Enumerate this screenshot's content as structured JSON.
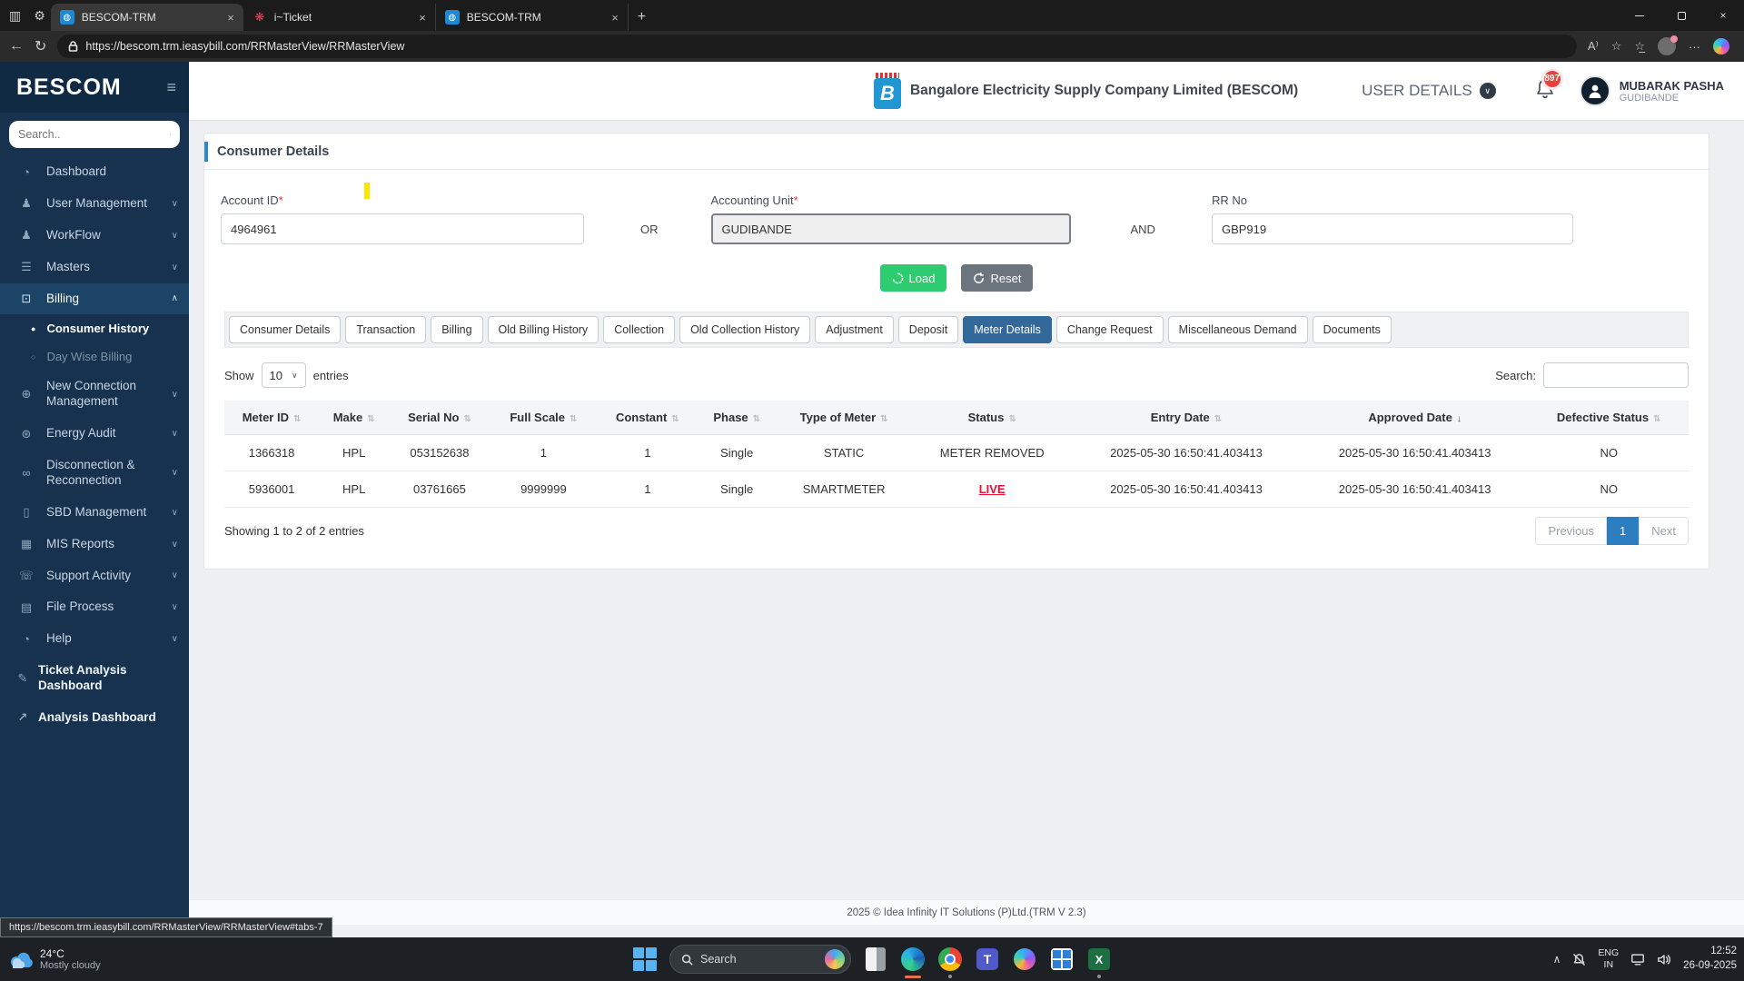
{
  "browser": {
    "tabs": [
      {
        "title": "BESCOM-TRM"
      },
      {
        "title": "i~Ticket"
      },
      {
        "title": "BESCOM-TRM"
      }
    ],
    "url": "https://bescom.trm.ieasybill.com/RRMasterView/RRMasterView"
  },
  "icons": {
    "hamburger": "≡",
    "chevron_down": "∨",
    "chevron_up": "∧",
    "sort": "⇅",
    "sort_desc": "↓",
    "back_arrow": "←",
    "refresh": "↻",
    "more": "···",
    "close": "×",
    "new_tab": "+",
    "read_aloud": "A⁾",
    "star": "☆",
    "tray_chevron": "∧"
  },
  "sidebar": {
    "brand": "BESCOM",
    "search_placeholder": "Search..",
    "items": [
      {
        "label": "Dashboard",
        "icon": "◔"
      },
      {
        "label": "User Management",
        "icon": "♟",
        "chevron": "∨"
      },
      {
        "label": "WorkFlow",
        "icon": "♟",
        "chevron": "∨"
      },
      {
        "label": "Masters",
        "icon": "☰",
        "chevron": "∨"
      },
      {
        "label": "Billing",
        "icon": "⊡",
        "chevron": "∧"
      },
      {
        "label": "New Connection Management",
        "icon": "⊕",
        "chevron": "∨"
      },
      {
        "label": "Energy Audit",
        "icon": "⊛",
        "chevron": "∨"
      },
      {
        "label": "Disconnection & Reconnection",
        "icon": "∞",
        "chevron": "∨"
      },
      {
        "label": "SBD Management",
        "icon": "▯",
        "chevron": "∨"
      },
      {
        "label": "MIS Reports",
        "icon": "▦",
        "chevron": "∨"
      },
      {
        "label": "Support Activity",
        "icon": "☏",
        "chevron": "∨"
      },
      {
        "label": "File Process",
        "icon": "▤",
        "chevron": "∨"
      },
      {
        "label": "Help",
        "icon": "◔",
        "chevron": "∨"
      },
      {
        "label": "Ticket Analysis Dashboard",
        "icon": "✎"
      },
      {
        "label": "Analysis Dashboard",
        "icon": "↗"
      }
    ],
    "billing_children": [
      {
        "label": "Consumer History",
        "bullet": "●"
      },
      {
        "label": "Day Wise Billing",
        "bullet": "○"
      }
    ]
  },
  "header": {
    "company": "Bangalore Electricity Supply Company Limited (BESCOM)",
    "logo_letter": "B",
    "user_details_label": "USER DETAILS",
    "notification_count": "897",
    "user_name": "MUBARAK PASHA",
    "user_location": "GUDIBANDE"
  },
  "form": {
    "title": "Consumer Details",
    "account_id": {
      "label": "Account ID",
      "required": "*",
      "value": "4964961"
    },
    "or_label": "OR",
    "accounting_unit": {
      "label": "Accounting Unit",
      "required": "*",
      "value": "GUDIBANDE"
    },
    "and_label": "AND",
    "rr_no": {
      "label": "RR No",
      "value": "GBP919"
    },
    "load_label": "Load",
    "reset_label": "Reset"
  },
  "tabs": {
    "active_index": 8,
    "items": [
      "Consumer Details",
      "Transaction",
      "Billing",
      "Old Billing History",
      "Collection",
      "Old Collection History",
      "Adjustment",
      "Deposit",
      "Meter Details",
      "Change Request",
      "Miscellaneous Demand",
      "Documents"
    ]
  },
  "table": {
    "show_label": "Show",
    "page_size": "10",
    "entries_label": "entries",
    "search_label": "Search:",
    "columns": [
      "Meter ID",
      "Make",
      "Serial No",
      "Full Scale",
      "Constant",
      "Phase",
      "Type of Meter",
      "Status",
      "Entry Date",
      "Approved Date",
      "Defective Status"
    ],
    "rows": [
      {
        "cells": [
          "1366318",
          "HPL",
          "053152638",
          "1",
          "1",
          "Single",
          "STATIC",
          "METER REMOVED",
          "2025-05-30 16:50:41.403413",
          "2025-05-30 16:50:41.403413",
          "NO"
        ]
      },
      {
        "cells": [
          "5936001",
          "HPL",
          "03761665",
          "9999999",
          "1",
          "Single",
          "SMARTMETER",
          "LIVE",
          "2025-05-30 16:50:41.403413",
          "2025-05-30 16:50:41.403413",
          "NO"
        ]
      }
    ],
    "info": "Showing 1 to 2 of 2 entries",
    "pagination": {
      "previous": "Previous",
      "current": "1",
      "next": "Next"
    }
  },
  "footer": {
    "text": "2025 © Idea Infinity IT Solutions (P)Ltd.(TRM V 2.3)"
  },
  "status_bar": {
    "link": "https://bescom.trm.ieasybill.com/RRMasterView/RRMasterView#tabs-7"
  },
  "taskbar": {
    "weather_temp": "24°C",
    "weather_condition": "Mostly cloudy",
    "search_placeholder": "Search",
    "language_line1": "ENG",
    "language_line2": "IN",
    "time": "12:52",
    "date": "26-09-2025"
  },
  "colors": {
    "active_tab_blue": "#33689B",
    "pagination_blue": "#2D7DC1",
    "live_red": "#E8112D",
    "load_green": "#2ECC71",
    "reset_gray": "#6C757D",
    "sidebar_bg": "#16324F",
    "badge_red": "#E8413C",
    "marker_yellow": "#FFE400"
  }
}
